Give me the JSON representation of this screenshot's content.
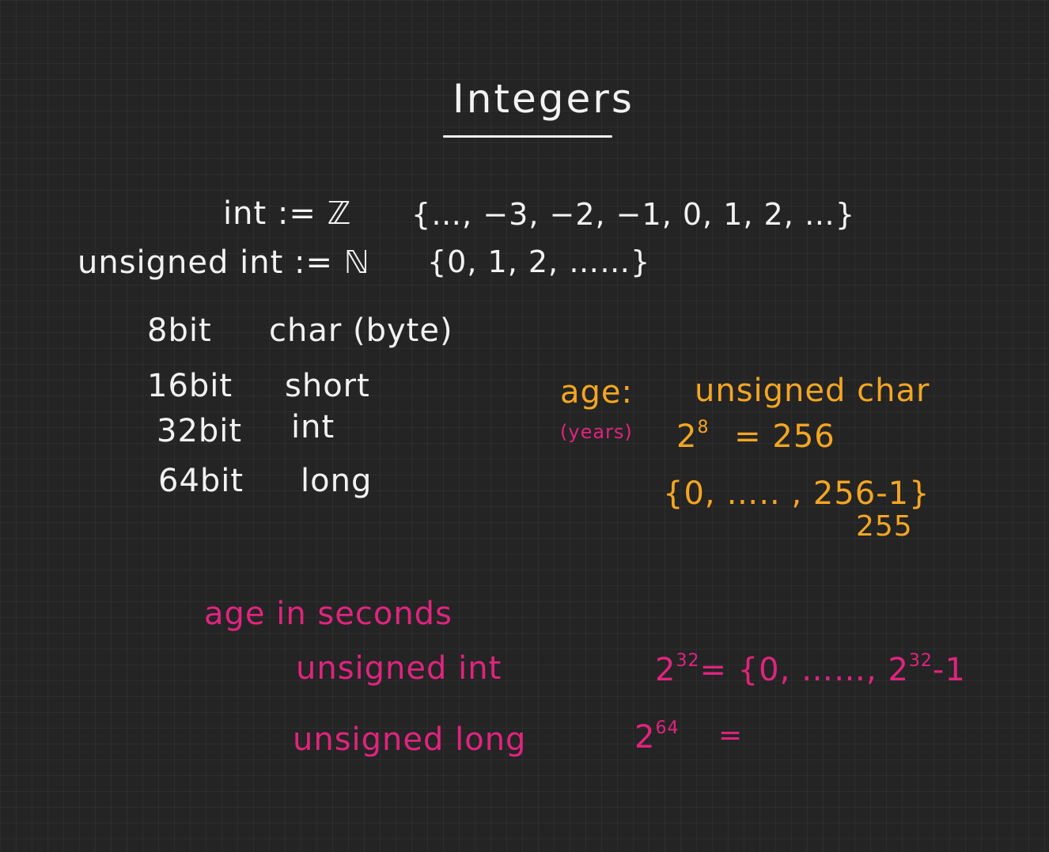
{
  "title": "Integers",
  "definitions": {
    "int_lhs": "int := ℤ",
    "int_set": "{…, −3, −2, −1, 0, 1, 2, …}",
    "uint_lhs": "unsigned int := ℕ",
    "uint_set": "{0, 1, 2, ……}"
  },
  "types": [
    {
      "bits": "8bit",
      "name": "char (byte)"
    },
    {
      "bits": "16bit",
      "name": "short"
    },
    {
      "bits": "32bit",
      "name": "int"
    },
    {
      "bits": "64bit",
      "name": "long"
    }
  ],
  "age_example": {
    "label": "age:",
    "type": "unsigned char",
    "note": "(years)",
    "power_base": "2",
    "power_exp": "8",
    "power_result": "= 256",
    "range": "{0, ….. , 256-1}",
    "range_value": "255"
  },
  "seconds_example": {
    "label": "age in seconds",
    "row1_type": "unsigned int",
    "row1_base": "2",
    "row1_exp": "32",
    "row1_eq": "= {0, ……, 2",
    "row1_tail_exp": "32",
    "row1_tail": "-1",
    "row2_type": "unsigned long",
    "row2_base": "2",
    "row2_exp": "64",
    "row2_eq": "="
  },
  "colors": {
    "background": "#242424",
    "ink_white": "#f2f2f2",
    "ink_orange": "#f5a623",
    "ink_magenta": "#e0247e"
  }
}
